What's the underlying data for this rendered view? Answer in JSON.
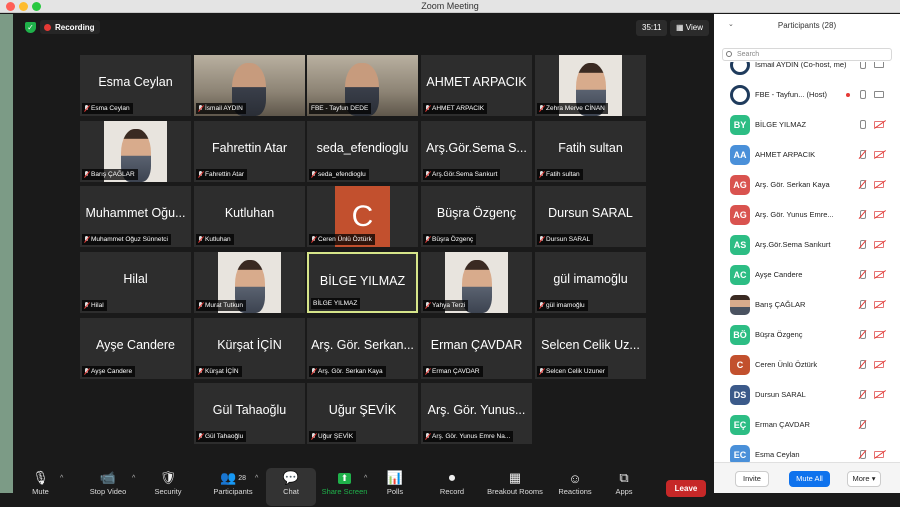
{
  "window_title": "Zoom Meeting",
  "top_bar": {
    "recording_label": "Recording",
    "timer": "35:11",
    "view_label": "View"
  },
  "tiles": [
    {
      "big": "Esma Ceylan",
      "label": "Esma Ceylan",
      "col": 0,
      "row": 0
    },
    {
      "big": "",
      "label": "İsmail AYDIN",
      "col": 1,
      "row": 0,
      "video": true
    },
    {
      "big": "",
      "label": "FBE - Tayfun DEDE",
      "col": 2,
      "row": 0,
      "video": true,
      "nomic": true
    },
    {
      "big": "AHMET ARPACIK",
      "label": "AHMET ARPACIK",
      "col": 3,
      "row": 0
    },
    {
      "big": "",
      "label": "Zehra Merve CİNAN",
      "col": 4,
      "row": 0,
      "photo": true
    },
    {
      "big": "",
      "label": "Barış ÇAĞLAR",
      "col": 0,
      "row": 1,
      "photo": true
    },
    {
      "big": "Fahrettin Atar",
      "label": "Fahrettin Atar",
      "col": 1,
      "row": 1
    },
    {
      "big": "seda_efendioglu",
      "label": "seda_efendioglu",
      "col": 2,
      "row": 1
    },
    {
      "big": "Arş.Gör.Sema S...",
      "label": "Arş.Gör.Sema Sarıkurt",
      "col": 3,
      "row": 1
    },
    {
      "big": "Fatih sultan",
      "label": "Fatih sultan",
      "col": 4,
      "row": 1
    },
    {
      "big": "Muhammet Oğu...",
      "label": "Muhammet Oğuz Sünnetci",
      "col": 0,
      "row": 2
    },
    {
      "big": "Kutluhan",
      "label": "Kutluhan",
      "col": 1,
      "row": 2
    },
    {
      "big": "",
      "label": "Ceren Ünlü Öztürk",
      "col": 2,
      "row": 2,
      "letter": "C"
    },
    {
      "big": "Büşra Özgenç",
      "label": "Büşra Özgenç",
      "col": 3,
      "row": 2
    },
    {
      "big": "Dursun SARAL",
      "label": "Dursun SARAL",
      "col": 4,
      "row": 2
    },
    {
      "big": "Hilal",
      "label": "Hilal",
      "col": 0,
      "row": 3
    },
    {
      "big": "",
      "label": "Murat Tutkun",
      "col": 1,
      "row": 3,
      "photo": true
    },
    {
      "big": "BİLGE  YILMAZ",
      "label": "BİLGE  YILMAZ",
      "col": 2,
      "row": 3,
      "highlight": true,
      "nomic": true
    },
    {
      "big": "",
      "label": "Yahya Terzi",
      "col": 3,
      "row": 3,
      "photo": true
    },
    {
      "big": "gül imamoğlu",
      "label": "gül imamoğlu",
      "col": 4,
      "row": 3
    },
    {
      "big": "Ayşe Candere",
      "label": "Ayşe Candere",
      "col": 0,
      "row": 4
    },
    {
      "big": "Kürşat İÇİN",
      "label": "Kürşat İÇİN",
      "col": 1,
      "row": 4
    },
    {
      "big": "Arş. Gör. Serkan...",
      "label": "Arş. Gör. Serkan Kaya",
      "col": 2,
      "row": 4
    },
    {
      "big": "Erman ÇAVDAR",
      "label": "Erman ÇAVDAR",
      "col": 3,
      "row": 4
    },
    {
      "big": "Selcen Celik Uz...",
      "label": "Selcen Celik Uzuner",
      "col": 4,
      "row": 4
    },
    {
      "big": "Gül Tahaoğlu",
      "label": "Gül Tahaoğlu",
      "col": 1,
      "row": 5
    },
    {
      "big": "Uğur ŞEVİK",
      "label": "Uğur ŞEVİK",
      "col": 2,
      "row": 5
    },
    {
      "big": "Arş. Gör. Yunus...",
      "label": "Arş. Gör. Yunus Emre Na...",
      "col": 3,
      "row": 5
    }
  ],
  "toolbar": [
    {
      "name": "mute",
      "label": "Mute",
      "icon": "microphone-icon",
      "glyph": "🎙",
      "chev": true
    },
    {
      "name": "stop-video",
      "label": "Stop Video",
      "icon": "video-camera-icon",
      "glyph": "📹",
      "chev": true
    },
    {
      "name": "security",
      "label": "Security",
      "icon": "shield-icon",
      "glyph": "🛡"
    },
    {
      "name": "participants",
      "label": "Participants",
      "icon": "participants-icon",
      "glyph": "👥",
      "count": "28",
      "chev": true
    },
    {
      "name": "chat",
      "label": "Chat",
      "icon": "chat-bubble-icon",
      "glyph": "💬"
    },
    {
      "name": "share-screen",
      "label": "Share Screen",
      "icon": "share-screen-icon",
      "glyph": "⬆",
      "chev": true,
      "green": true
    },
    {
      "name": "polls",
      "label": "Polls",
      "icon": "polls-icon",
      "glyph": "📊"
    },
    {
      "name": "record",
      "label": "Record",
      "icon": "record-icon",
      "glyph": "⏺"
    },
    {
      "name": "breakout-rooms",
      "label": "Breakout Rooms",
      "icon": "breakout-rooms-icon",
      "glyph": "▦"
    },
    {
      "name": "reactions",
      "label": "Reactions",
      "icon": "reactions-icon",
      "glyph": "☺"
    },
    {
      "name": "apps",
      "label": "Apps",
      "icon": "apps-icon",
      "glyph": "⧉"
    }
  ],
  "leave_label": "Leave",
  "participants_panel": {
    "title": "Participants (28)",
    "search_placeholder": "Search",
    "items": [
      {
        "name": "İsmail AYDIN (Co-host, me)",
        "initials": "",
        "color": "#1f3b5c",
        "mic": "on",
        "cam": "on",
        "logo": true
      },
      {
        "name": "FBE - Tayfun... (Host)",
        "initials": "",
        "color": "#1f3b5c",
        "mic": "on",
        "cam": "on",
        "logo": true,
        "rec": true
      },
      {
        "name": "BİLGE  YILMAZ",
        "initials": "BY",
        "color": "#2dbd84",
        "mic": "on",
        "cam": "off"
      },
      {
        "name": "AHMET ARPACIK",
        "initials": "AA",
        "color": "#4a90d9",
        "mic": "off",
        "cam": "off"
      },
      {
        "name": "Arş. Gör. Serkan Kaya",
        "initials": "AG",
        "color": "#d9534f",
        "mic": "off",
        "cam": "off"
      },
      {
        "name": "Arş. Gör. Yunus Emre...",
        "initials": "AG",
        "color": "#d9534f",
        "mic": "off",
        "cam": "off"
      },
      {
        "name": "Arş.Gör.Sema Sarıkurt",
        "initials": "AS",
        "color": "#2dbd84",
        "mic": "off",
        "cam": "off"
      },
      {
        "name": "Ayşe Candere",
        "initials": "AC",
        "color": "#2dbd84",
        "mic": "off",
        "cam": "off"
      },
      {
        "name": "Barış ÇAĞLAR",
        "initials": "",
        "color": "#8a6a4f",
        "mic": "off",
        "cam": "off",
        "photo": true
      },
      {
        "name": "Büşra Özgenç",
        "initials": "BÖ",
        "color": "#2dbd84",
        "mic": "off",
        "cam": "off"
      },
      {
        "name": "Ceren Ünlü Öztürk",
        "initials": "C",
        "color": "#c2502e",
        "mic": "off",
        "cam": "off"
      },
      {
        "name": "Dursun SARAL",
        "initials": "DS",
        "color": "#3b5a8a",
        "mic": "off",
        "cam": "off"
      },
      {
        "name": "Erman ÇAVDAR",
        "initials": "EÇ",
        "color": "#2dbd84",
        "mic": "off",
        "cam": "none"
      },
      {
        "name": "Esma Ceylan",
        "initials": "EC",
        "color": "#4a90d9",
        "mic": "off",
        "cam": "off"
      }
    ],
    "footer": {
      "invite": "Invite",
      "mute_all": "Mute All",
      "more": "More"
    }
  }
}
